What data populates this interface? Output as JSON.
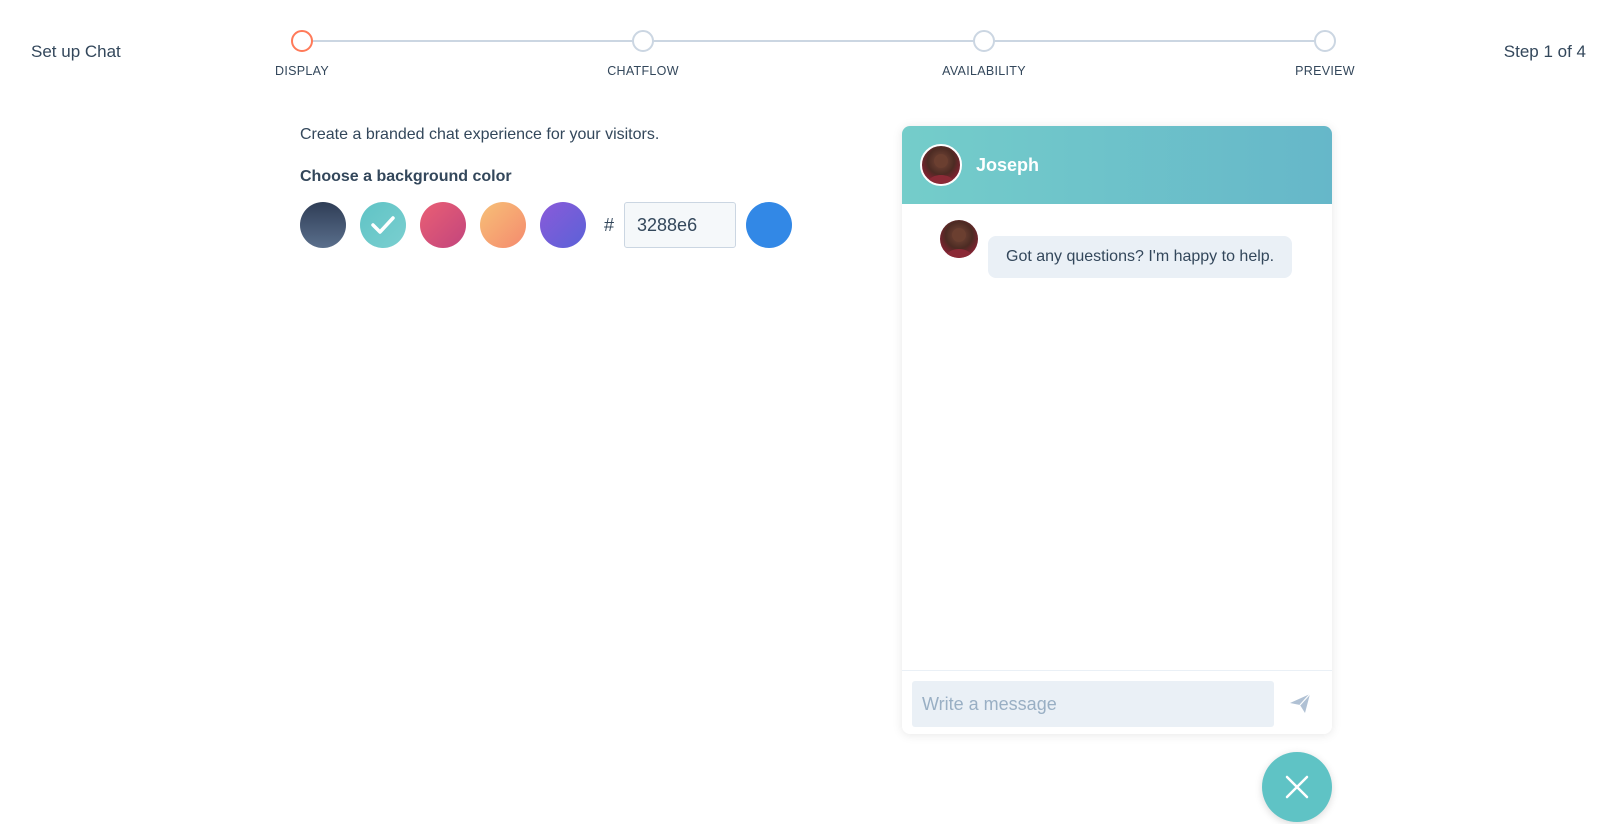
{
  "header": {
    "title": "Set up Chat",
    "step_counter": "Step 1 of 4",
    "steps": [
      {
        "label": "DISPLAY",
        "active": true
      },
      {
        "label": "CHATFLOW",
        "active": false
      },
      {
        "label": "AVAILABILITY",
        "active": false
      },
      {
        "label": "PREVIEW",
        "active": false
      }
    ]
  },
  "form": {
    "intro": "Create a branded chat experience for your visitors.",
    "color_heading": "Choose a background color",
    "swatches": [
      {
        "name": "dark-slate",
        "selected": false
      },
      {
        "name": "teal",
        "selected": true
      },
      {
        "name": "pink",
        "selected": false
      },
      {
        "name": "orange",
        "selected": false
      },
      {
        "name": "purple",
        "selected": false
      }
    ],
    "hash_symbol": "#",
    "hex_value": "3288e6",
    "custom_color": "#3288e6"
  },
  "chat": {
    "agent_name": "Joseph",
    "message": "Got any questions? I'm happy to help.",
    "input_placeholder": "Write a message",
    "header_color": "#74cdca",
    "send_icon": "paper-plane-icon",
    "launcher_icon": "close-icon"
  },
  "colors": {
    "accent_active_step": "#ff7a59",
    "inactive_step": "#cbd6e2",
    "text": "#33475b"
  }
}
